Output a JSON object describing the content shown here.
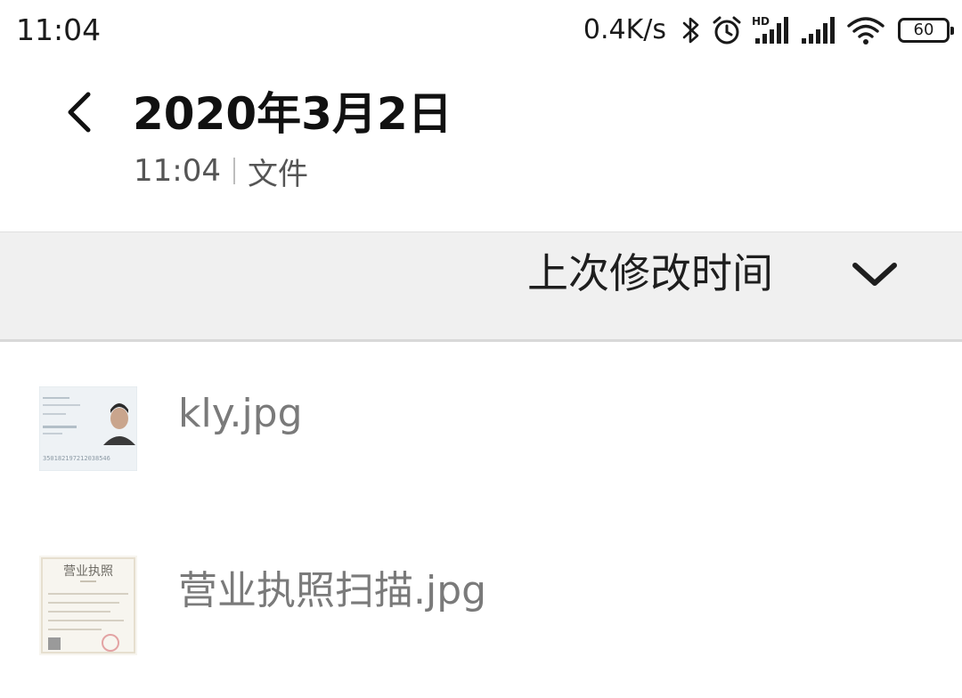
{
  "status_bar": {
    "time": "11:04",
    "net_speed": "0.4K/s",
    "icons": [
      "bluetooth-icon",
      "alarm-icon",
      "hd-signal-icon",
      "signal-icon",
      "wifi-icon",
      "battery-icon"
    ],
    "hd_label": "HD",
    "battery_level": "60"
  },
  "header": {
    "back_icon": "chevron-left-icon",
    "title": "2020年3月2日",
    "subtitle_time": "11:04",
    "subtitle_type": "文件"
  },
  "sort_bar": {
    "label": "上次修改时间",
    "icon": "chevron-down-icon"
  },
  "files": [
    {
      "name": "kly.jpg",
      "thumbnail": "id-card-thumbnail",
      "thumbnail_text": "350182197212038546"
    },
    {
      "name": "营业执照扫描.jpg",
      "thumbnail": "business-license-thumbnail",
      "thumbnail_text": "营业执照"
    }
  ],
  "colors": {
    "background": "#ffffff",
    "sort_bar_bg": "#f0f0f0",
    "title_text": "#111111",
    "secondary_text": "#555555",
    "file_name_text": "#7a7a7a"
  }
}
